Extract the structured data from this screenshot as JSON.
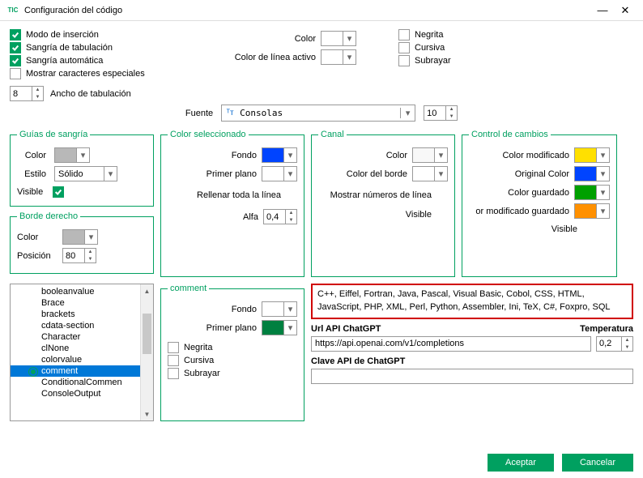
{
  "title": "Configuración del código",
  "top": {
    "insert": "Modo de inserción",
    "tabindent": "Sangría de tabulación",
    "autoindent": "Sangría automática",
    "specialchars": "Mostrar caracteres especiales",
    "tabwidth_val": "8",
    "tabwidth_lbl": "Ancho de tabulación",
    "color": "Color",
    "activeline": "Color de línea activo",
    "bold": "Negrita",
    "italic": "Cursiva",
    "underline": "Subrayar",
    "font_lbl": "Fuente",
    "font_val": "Consolas",
    "size_val": "10"
  },
  "guides": {
    "legend": "Guías de sangría",
    "color": "Color",
    "style": "Estilo",
    "style_val": "Sólido",
    "visible": "Visible"
  },
  "rightedge": {
    "legend": "Borde derecho",
    "color": "Color",
    "position": "Posición",
    "position_val": "80"
  },
  "selcolor": {
    "legend": "Color seleccionado",
    "bg": "Fondo",
    "fg": "Primer plano",
    "fill": "Rellenar toda la línea",
    "alpha": "Alfa",
    "alpha_val": "0,4"
  },
  "gutter": {
    "legend": "Canal",
    "color": "Color",
    "border": "Color del borde",
    "linenums": "Mostrar números de línea",
    "visible": "Visible"
  },
  "changes": {
    "legend": "Control de cambios",
    "mod": "Color modificado",
    "orig": "Original Color",
    "saved": "Color guardado",
    "modsaved": "or modificado guardado",
    "visible": "Visible"
  },
  "list": [
    "booleanvalue",
    "Brace",
    "brackets",
    "cdata-section",
    "Character",
    "clNone",
    "colorvalue",
    "comment",
    "ConditionalCommen",
    "ConsoleOutput"
  ],
  "comment_fs": {
    "legend": "comment",
    "bg": "Fondo",
    "fg": "Primer plano",
    "bold": "Negrita",
    "italic": "Cursiva",
    "underline": "Subrayar"
  },
  "langs": "C++, Eiffel, Fortran, Java, Pascal, Visual Basic, Cobol, CSS, HTML, JavaScript, PHP, XML, Perl, Python, Assembler, Ini, TeX, C#, Foxpro, SQL",
  "api": {
    "url_lbl": "Url API ChatGPT",
    "url_val": "https://api.openai.com/v1/completions",
    "temp_lbl": "Temperatura",
    "temp_val": "0,2",
    "key_lbl": "Clave API de ChatGPT"
  },
  "buttons": {
    "ok": "Aceptar",
    "cancel": "Cancelar"
  },
  "colors": {
    "gray": "#b8b8b8",
    "blue": "#0044ff",
    "white": "#ffffff",
    "darkgreen": "#008040",
    "lightgray": "#f4f4f4",
    "yellow": "#ffe000",
    "green": "#00a000",
    "orange": "#ff9000",
    "faint": "#f8f8f8"
  }
}
